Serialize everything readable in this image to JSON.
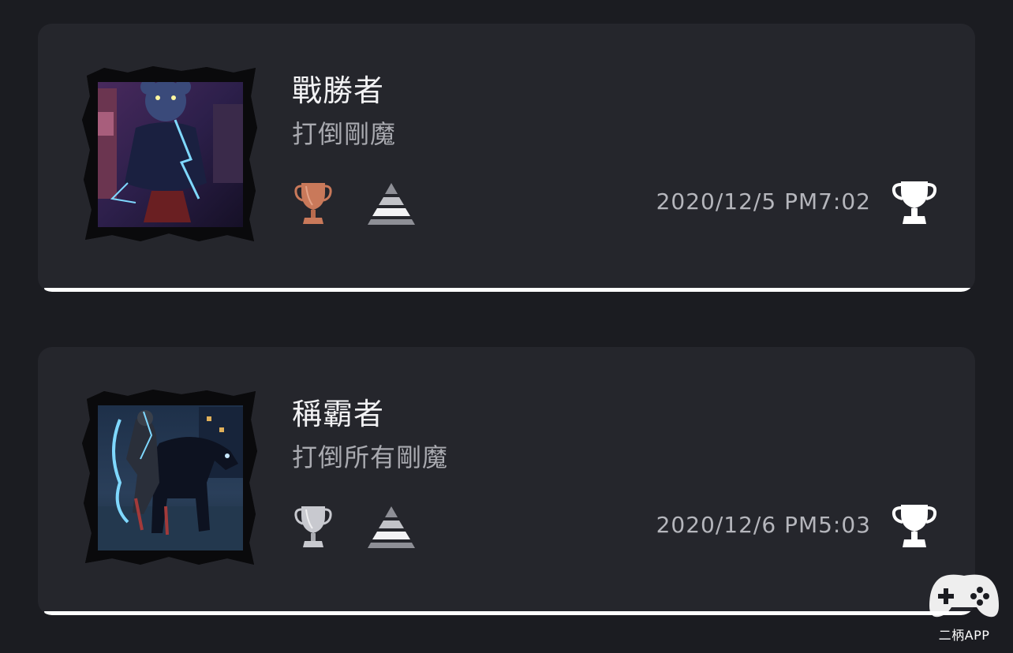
{
  "trophies": [
    {
      "name": "戰勝者",
      "description": "打倒剛魔",
      "grade": "bronze",
      "grade_color": "#c9795a",
      "timestamp": "2020/12/5  PM7:02",
      "earned": true
    },
    {
      "name": "稱霸者",
      "description": "打倒所有剛魔",
      "grade": "silver",
      "grade_color": "#c8c9cf",
      "timestamp": "2020/12/6  PM5:03",
      "earned": true
    }
  ],
  "watermark": {
    "label": "二柄APP"
  }
}
